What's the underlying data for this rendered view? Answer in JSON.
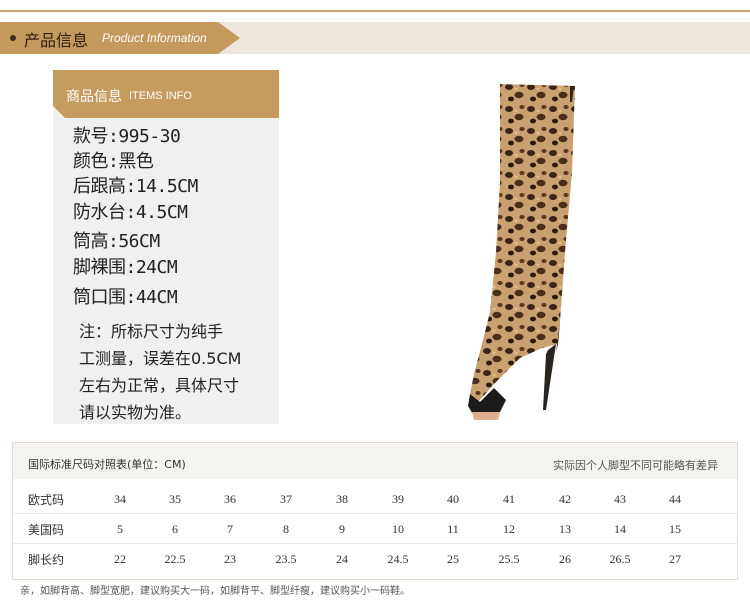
{
  "header": {
    "title_cn": "产品信息",
    "title_en": "Product Information"
  },
  "info": {
    "title_cn": "商品信息",
    "title_en": "ITEMS INFO",
    "specs": [
      "款号:995-30",
      "颜色:黑色",
      "后跟高:14.5CM",
      "防水台:4.5CM",
      "筒高:56CM",
      "脚裸围:24CM",
      "筒口围:44CM"
    ],
    "note_lines": [
      "注：所标尺寸为纯手",
      "工测量，误差在0.5CM",
      "左右为正常，具体尺寸",
      "请以实物为准。"
    ]
  },
  "size_table": {
    "title": "国际标准尺码对照表(单位：CM)",
    "note": "实际因个人脚型不同可能略有差异",
    "rows": [
      {
        "label": "欧式码",
        "values": [
          "34",
          "35",
          "36",
          "37",
          "38",
          "39",
          "40",
          "41",
          "42",
          "43",
          "44"
        ]
      },
      {
        "label": "美国码",
        "values": [
          "5",
          "6",
          "7",
          "8",
          "9",
          "10",
          "11",
          "12",
          "13",
          "14",
          "15"
        ]
      },
      {
        "label": "脚长约",
        "values": [
          "22",
          "22.5",
          "23",
          "23.5",
          "24",
          "24.5",
          "25",
          "25.5",
          "26",
          "26.5",
          "27"
        ]
      }
    ]
  },
  "footer": "亲，如脚背高、脚型宽肥，建议购买大一码，如脚背平、脚型纤瘦，建议购买小一码鞋。",
  "colors": {
    "accent": "#c69c5e",
    "leopard_base": "#c9a070",
    "spot": "#3a2418"
  },
  "icons": {
    "header_bullet": "dot-icon"
  }
}
